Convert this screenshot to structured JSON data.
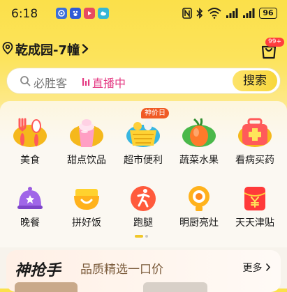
{
  "status_bar": {
    "time": "6:18",
    "battery": "96",
    "notif_icons": [
      "security-app-icon",
      "baidu-app-icon",
      "video-app-icon",
      "cloud-app-icon"
    ],
    "sys_icons": [
      "nfc-icon",
      "bluetooth-icon",
      "wifi-icon",
      "signal-1-icon",
      "signal-2-icon"
    ]
  },
  "header": {
    "location": "乾成园-7幢",
    "cart_badge": "99+"
  },
  "search": {
    "placeholder": "必胜客",
    "live_label": "直播中",
    "button_label": "搜索"
  },
  "categories": [
    {
      "label": "美食",
      "icon": "food-utensils-icon"
    },
    {
      "label": "甜点饮品",
      "icon": "dessert-drink-icon"
    },
    {
      "label": "超市便利",
      "icon": "supermarket-basket-icon",
      "tag": "神价日"
    },
    {
      "label": "蔬菜水果",
      "icon": "fruit-vegetable-icon"
    },
    {
      "label": "看病买药",
      "icon": "medicine-kit-icon"
    },
    {
      "label": "晚餐",
      "icon": "dinner-cloche-icon"
    },
    {
      "label": "拼好饭",
      "icon": "group-meal-icon"
    },
    {
      "label": "跑腿",
      "icon": "errand-runner-icon"
    },
    {
      "label": "明厨亮灶",
      "icon": "kitchen-camera-icon"
    },
    {
      "label": "天天津贴",
      "icon": "daily-subsidy-icon"
    }
  ],
  "promo": {
    "brand": "神抢手",
    "slogan": "品质精选一口价",
    "more": "更多"
  },
  "colors": {
    "brand_yellow": "#fbe04a",
    "live_pink": "#e43a83",
    "badge_red": "#ff3d3d",
    "tag_orange": "#f05a24"
  }
}
